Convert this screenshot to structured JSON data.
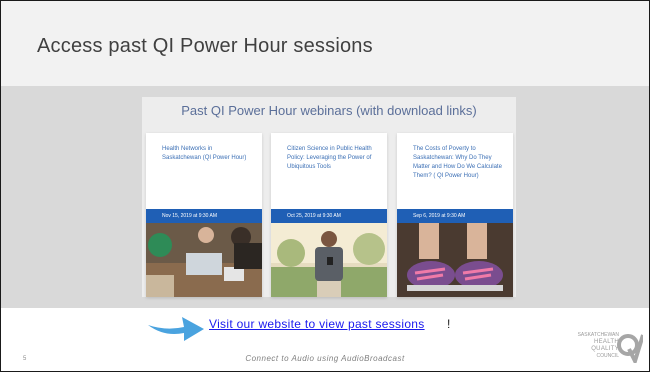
{
  "slide": {
    "title": "Access past QI Power Hour sessions",
    "number": "5",
    "footer": "Connect to Audio using AudioBroadcast"
  },
  "panel": {
    "heading": "Past QI Power Hour webinars (with download links)",
    "cards": [
      {
        "title": "Health Networks in Saskatchewan (QI Power Hour)",
        "date": "Nov 15, 2019 at 9:30 AM",
        "image_icon": "group-laptops-photo"
      },
      {
        "title": "Citizen Science in Public Health Policy: Leveraging the Power of Ubiquitous Tools",
        "date": "Oct 25, 2019 at 9:30 AM",
        "image_icon": "man-with-phone-photo"
      },
      {
        "title": "The Costs of Poverty to Saskatchewan: Why Do They Matter and How Do We Calculate Them? ( QI Power Hour)",
        "date": "Sep 6, 2019 at 9:30 AM",
        "image_icon": "sneakers-photo"
      }
    ]
  },
  "cta": {
    "link_text": "Visit our website to view past sessions",
    "suffix": "!"
  },
  "logo": {
    "line1": "SASKATCHEWAN",
    "line2": "HEALTH",
    "line3": "QUALITY",
    "line4": "COUNCIL"
  },
  "colors": {
    "title_band": "#f2f2f2",
    "content_band": "#d9d9d9",
    "card_title": "#3b6fb5",
    "date_bar": "#1f5fb5",
    "arrow": "#4aa3df",
    "link": "#1a1aee"
  }
}
